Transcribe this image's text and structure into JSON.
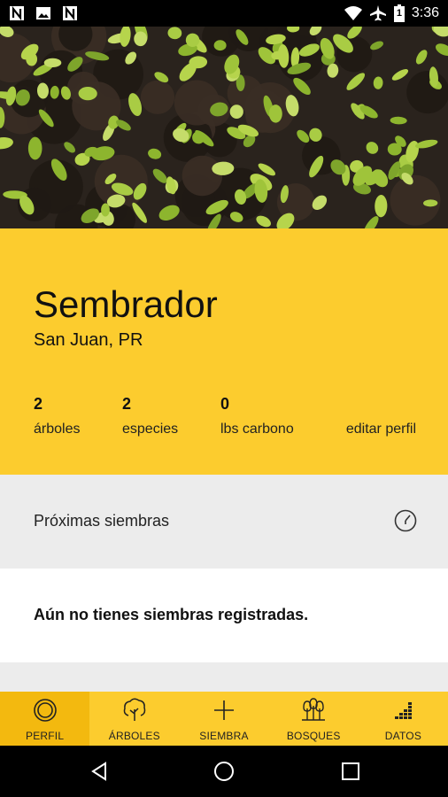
{
  "status_bar": {
    "time": "3:36",
    "battery_level": "1",
    "icons": [
      "n-app-icon",
      "image-icon",
      "n-app-icon",
      "wifi-icon",
      "airplane-icon",
      "battery-icon"
    ]
  },
  "hero": {
    "image": "seedlings-photo"
  },
  "profile": {
    "name": "Sembrador",
    "location": "San Juan, PR",
    "stats": [
      {
        "value": "2",
        "label": "árboles"
      },
      {
        "value": "2",
        "label": "especies"
      },
      {
        "value": "0",
        "label": "lbs carbono"
      }
    ],
    "edit_label": "editar perfil"
  },
  "upcoming": {
    "title": "Próximas siembras",
    "icon": "clock-icon",
    "empty_message": "Aún no tienes siembras registradas."
  },
  "tabs": [
    {
      "label": "PERFIL",
      "icon": "profile-icon",
      "active": true
    },
    {
      "label": "ÁRBOLES",
      "icon": "tree-icon",
      "active": false
    },
    {
      "label": "SIEMBRA",
      "icon": "plus-icon",
      "active": false
    },
    {
      "label": "BOSQUES",
      "icon": "forest-icon",
      "active": false
    },
    {
      "label": "DATOS",
      "icon": "chart-icon",
      "active": false
    }
  ],
  "nav": {
    "icons": [
      "back-icon",
      "home-icon",
      "recents-icon"
    ]
  },
  "colors": {
    "accent": "#fccc2e",
    "accent_dark": "#f3b90f",
    "section_bg": "#ececec"
  }
}
